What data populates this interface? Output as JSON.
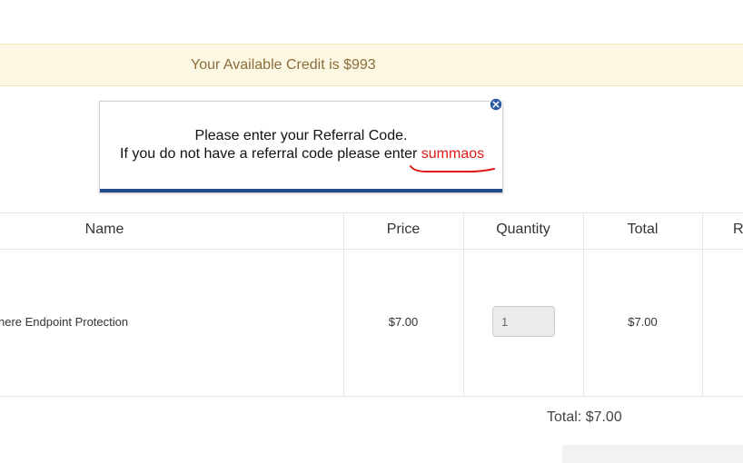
{
  "credit_banner": {
    "text": "Your Available Credit is $993"
  },
  "referral_popup": {
    "line1": "Please enter your Referral Code.",
    "line2_prefix": "If you do not have a referral code please enter ",
    "code": "summaos",
    "close_icon": "close-icon",
    "accent_color": "#234a8c",
    "code_color": "#e01818"
  },
  "cart_table": {
    "columns": [
      "Name",
      "Price",
      "Quantity",
      "Total",
      "R"
    ],
    "rows": [
      {
        "name": "nere Endpoint Protection",
        "price": "$7.00",
        "quantity": "1",
        "total": "$7.00"
      }
    ]
  },
  "cart_total": {
    "text": "Total: $7.00"
  }
}
